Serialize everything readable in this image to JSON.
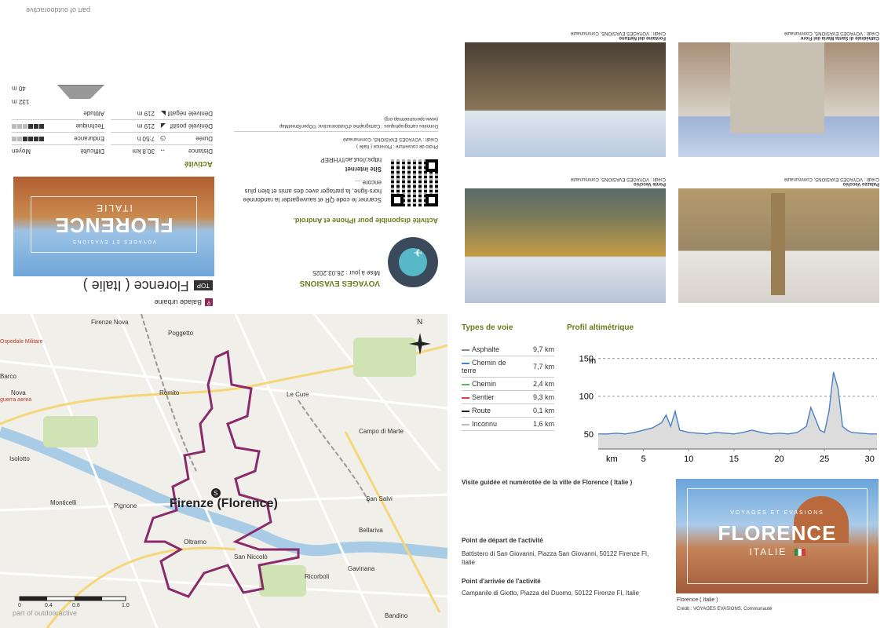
{
  "outdooractive": "part of outdooractive",
  "activity": {
    "category": "Balade urbaine",
    "top_badge": "TOP",
    "title": "Florence ( Italie )",
    "section_label": "Activité",
    "stats": [
      {
        "label": "Distance",
        "value": "30,8 km"
      },
      {
        "label": "Durée",
        "value": "7:50 h"
      },
      {
        "label": "Dénivelé positif",
        "value": "219 m"
      },
      {
        "label": "Dénivelé négatif",
        "value": "219 m"
      }
    ],
    "ratings": [
      {
        "label": "Difficulté",
        "value": "Moyen"
      },
      {
        "label": "Endurance",
        "filled": 4,
        "total": 6
      },
      {
        "label": "Technique",
        "filled": 3,
        "total": 6
      },
      {
        "label": "Altitude",
        "max": "132 m",
        "min": "40 m"
      }
    ]
  },
  "brand": {
    "name": "VOYAGES EVASIONS",
    "updated": "Mise à jour : 26.03.2025",
    "app_line": "Activité disponible pour iPhone et Android.",
    "qr_text": "Scanner le code QR et sauvegarder la randonnée hors-ligne, la partager avec des amis et bien plus encore ...",
    "site_label": "Site internet",
    "site_url": "https://out.ac/IYHREP",
    "credit_photo": "Photo de couverture : Florence ( Italie )",
    "credit_photo2": "Crédit : VOYAGES EVASIONS, Communauté",
    "map_credit": "Données cartographiques : Cartographie d'Outdooractive; ©OpenStreetMap (www.openstreetmap.org)"
  },
  "cover": {
    "kicker": "VOYAGES ET EVASIONS",
    "title": "FLORENCE",
    "subtitle": "ITALIE",
    "caption": "Florence ( Italie )",
    "credit": "Crédit : VOYAGES EVASIONS, Communauté"
  },
  "photos": [
    {
      "title": "Cathédrale di Santa Maria del Fiore",
      "credit": "Crédit : VOYAGES EVASIONS, Communauté"
    },
    {
      "title": "Fontaine del Nettuno",
      "credit": "Crédit : VOYAGES EVASIONS, Communauté"
    },
    {
      "title": "Palazzo Vecchio",
      "credit": "Crédit : VOYAGES EVASIONS, Communauté"
    },
    {
      "title": "Ponte Vecchio",
      "credit": "Crédit : VOYAGES EVASIONS, Communauté"
    }
  ],
  "map": {
    "city_label": "Firenze (Florence)",
    "labels": [
      "Firenze Nova",
      "Poggetto",
      "Romito",
      "Le Cure",
      "Campo di Marte",
      "Isolotto",
      "Monticelli",
      "Pignone",
      "Oltrarno",
      "San Niccolò",
      "San Salvi",
      "Bellariva",
      "Gavinana",
      "Ricorboli",
      "Bandino",
      "Barco",
      "Nova",
      "Ospedale Militare",
      "guerra aerea"
    ],
    "north": "N",
    "scale": [
      "0",
      "0.4",
      "0.8",
      "1.0"
    ],
    "watermark": "part of outdooractive"
  },
  "types_de_voie": {
    "title": "Types de voie",
    "rows": [
      {
        "name": "Asphalte",
        "value": "9,7 km",
        "color": "#888888"
      },
      {
        "name": "Chemin de terre",
        "value": "7,7 km",
        "color": "#4a80c8"
      },
      {
        "name": "Chemin",
        "value": "2,4 km",
        "color": "#5cb85c"
      },
      {
        "name": "Sentier",
        "value": "9,3 km",
        "color": "#e04040"
      },
      {
        "name": "Route",
        "value": "0,1 km",
        "color": "#222222"
      },
      {
        "name": "Inconnu",
        "value": "1,6 km",
        "color": "#bbbbbb"
      }
    ]
  },
  "chart_data": {
    "type": "area",
    "title": "Profil altimétrique",
    "xlabel": "km",
    "ylabel": "m",
    "xlim": [
      0,
      30.8
    ],
    "ylim": [
      30,
      160
    ],
    "xticks": [
      5,
      10,
      15,
      20,
      25,
      30
    ],
    "yticks": [
      50,
      100,
      150
    ],
    "x": [
      0,
      1,
      2,
      3,
      4,
      5,
      6,
      7,
      7.5,
      8,
      8.5,
      9,
      10,
      11,
      12,
      13,
      14,
      15,
      16,
      17,
      18,
      19,
      20,
      21,
      22,
      23,
      23.5,
      24,
      24.5,
      25,
      25.5,
      26,
      26.5,
      27,
      27.5,
      28,
      29,
      30,
      30.8
    ],
    "y": [
      50,
      50,
      51,
      50,
      52,
      55,
      58,
      65,
      75,
      60,
      80,
      55,
      52,
      51,
      50,
      52,
      51,
      50,
      52,
      55,
      52,
      50,
      51,
      50,
      52,
      60,
      85,
      70,
      55,
      52,
      80,
      132,
      110,
      60,
      55,
      52,
      51,
      50,
      50
    ]
  },
  "description": {
    "title": "Visite guidée et numérotée de la ville de Florence ( Italie )",
    "start_label": "Point de départ de l'activité",
    "start_value": "Battistero di San Giovanni, Piazza San Giovanni, 50122 Firenze FI, Italie",
    "end_label": "Point d'arrivée de l'activité",
    "end_value": "Campanile di Giotto, Piazza del Duomo, 50122 Firenze FI, Italie"
  }
}
